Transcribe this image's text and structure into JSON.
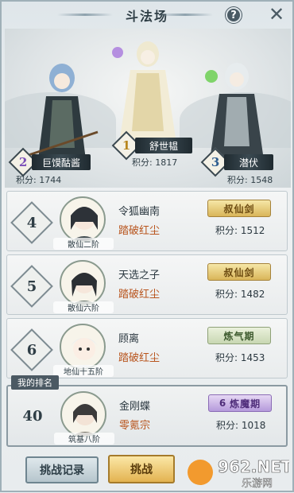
{
  "header": {
    "title": "斗法场",
    "help_label": "?",
    "close_label": "✕"
  },
  "podium": [
    {
      "rank": "1",
      "name": "舒世韫",
      "score_label": "积分:",
      "score": "1817"
    },
    {
      "rank": "2",
      "name": "巨馍酤酱",
      "score_label": "积分:",
      "score": "1744"
    },
    {
      "rank": "3",
      "name": "潜伏",
      "score_label": "积分:",
      "score": "1548"
    }
  ],
  "rows": [
    {
      "rank": "4",
      "name": "令狐幽南",
      "stage": "踏破红尘",
      "avatar_caption": "散仙二阶",
      "badge": "叔仙剑",
      "badge_style": "gold",
      "score_label": "积分:",
      "score": "1512"
    },
    {
      "rank": "5",
      "name": "天选之子",
      "stage": "踏破红尘",
      "avatar_caption": "散仙六阶",
      "badge": "叔仙剑",
      "badge_style": "gold",
      "score_label": "积分:",
      "score": "1482"
    },
    {
      "rank": "6",
      "name": "顾离",
      "stage": "踏破红尘",
      "avatar_caption": "地仙十五阶",
      "badge": "炼气期",
      "badge_style": "green",
      "score_label": "积分:",
      "score": "1453"
    }
  ],
  "my_rank": {
    "tag": "我的排名",
    "rank": "40",
    "name": "金刚蝶",
    "stage": "零氪宗",
    "avatar_caption": "筑基八阶",
    "badge": "炼魔期",
    "badge_prefix": "6",
    "score_label": "积分:",
    "score": "1018"
  },
  "buttons": {
    "record": "挑战记录",
    "fight": "挑战"
  },
  "watermark": {
    "brand": "962.NET",
    "sub": "乐游网"
  }
}
